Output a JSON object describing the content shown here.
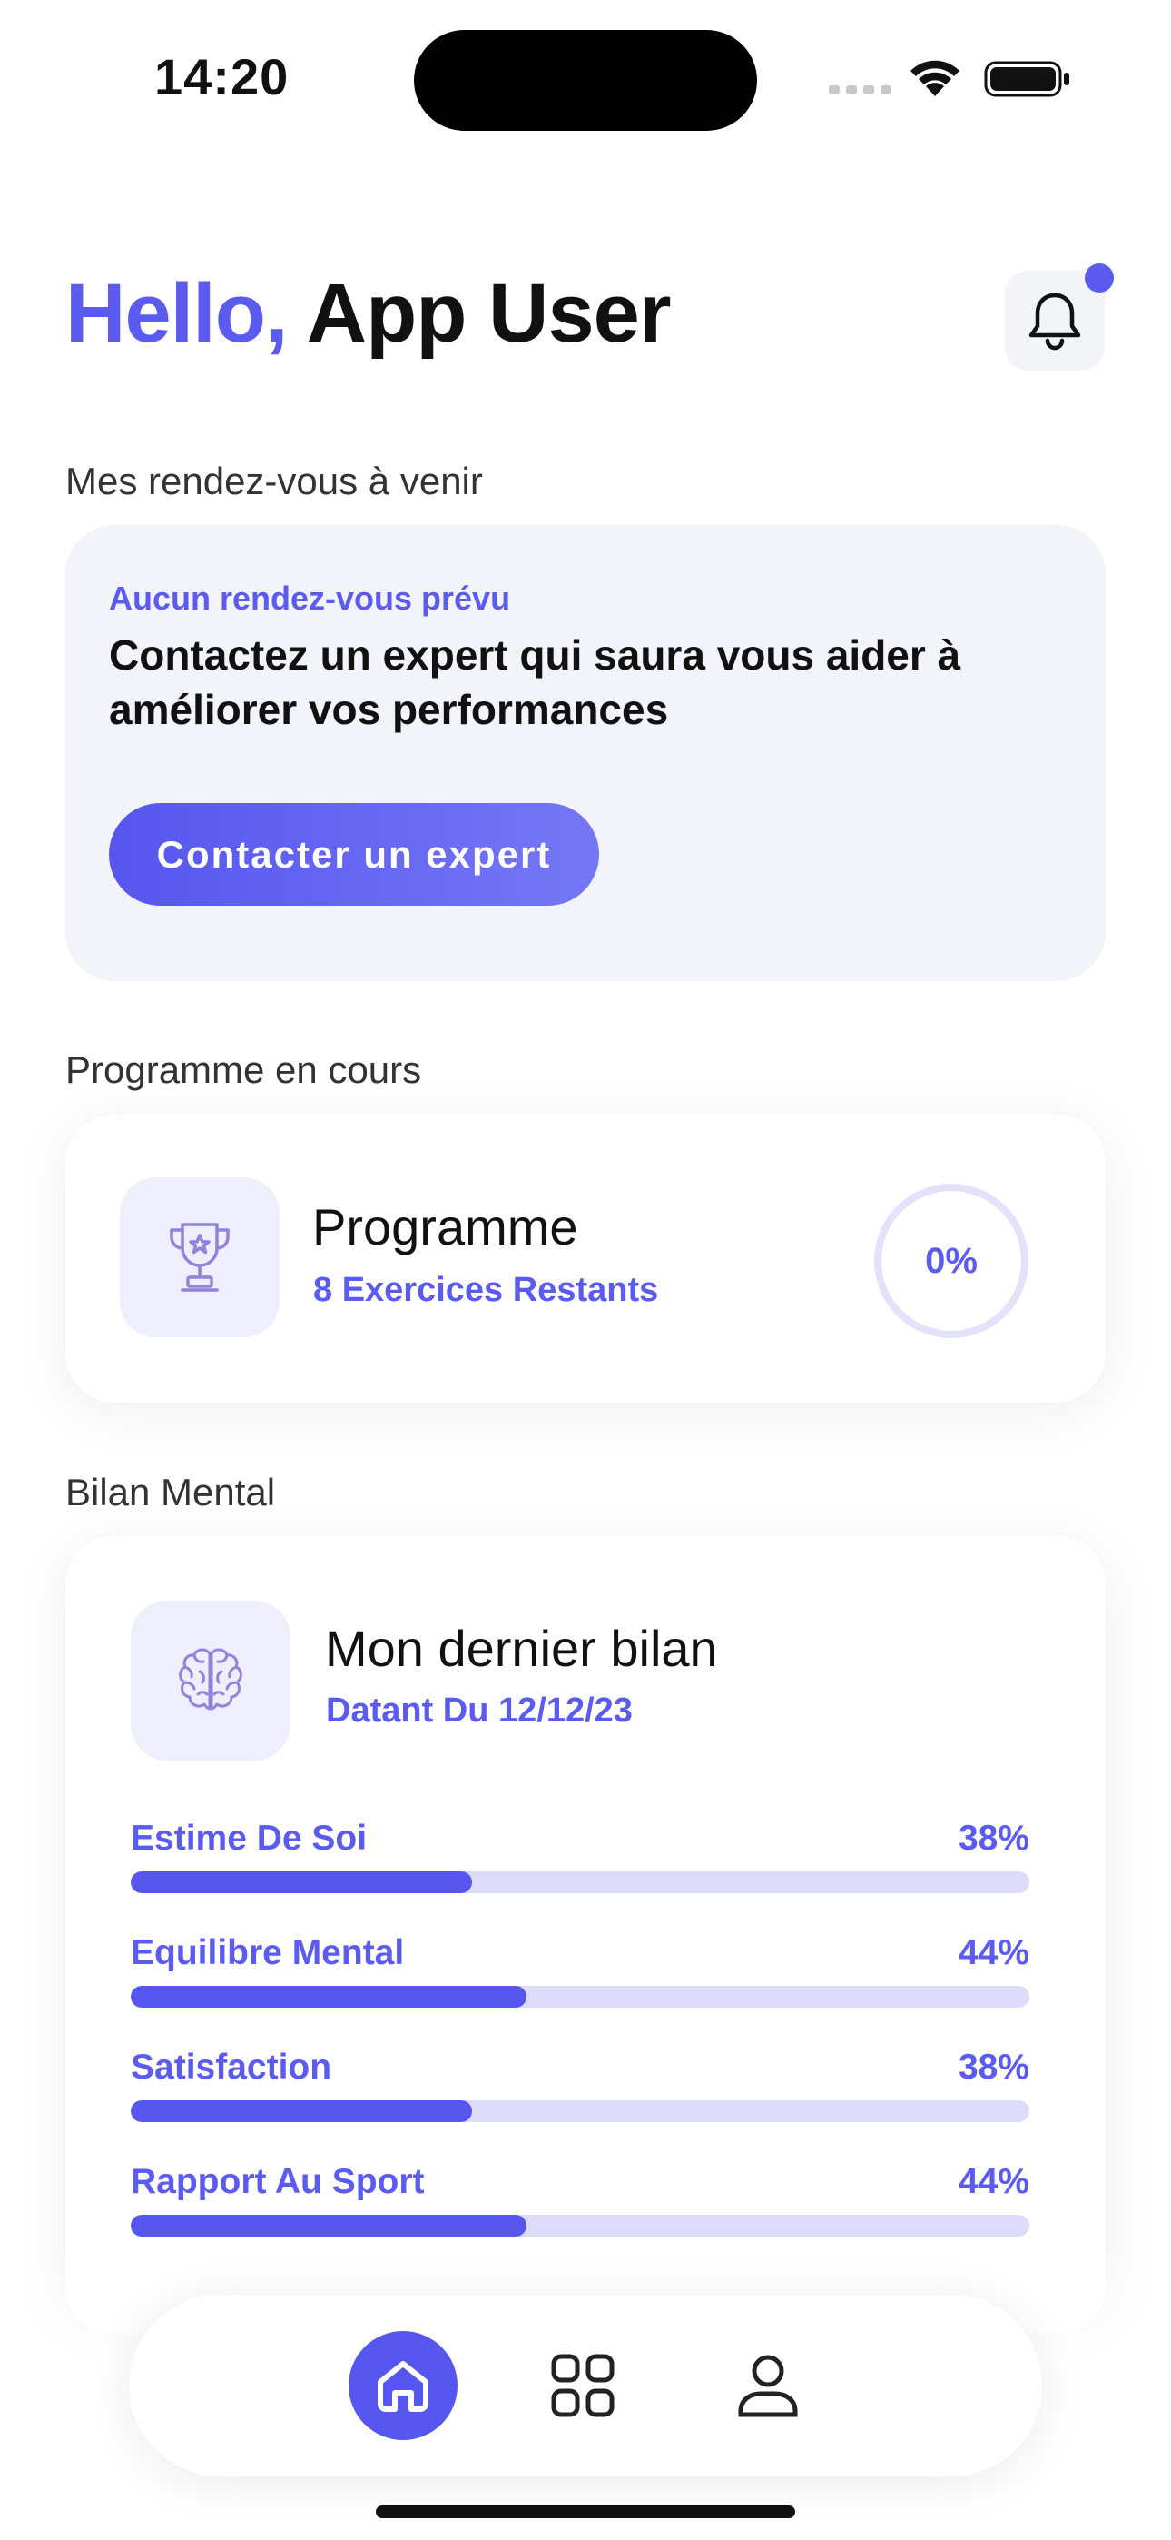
{
  "status_bar": {
    "time": "14:20"
  },
  "header": {
    "hello": "Hello,",
    "user_name": "App User"
  },
  "appointments": {
    "section_title": "Mes rendez-vous à venir",
    "caption": "Aucun rendez-vous prévu",
    "message": "Contactez un expert qui saura vous aider à améliorer vos performances",
    "button_label": "Contacter un expert"
  },
  "program": {
    "section_title": "Programme en cours",
    "title": "Programme",
    "subtitle": "8 Exercices Restants",
    "progress_label": "0%",
    "progress": 0
  },
  "bilan": {
    "section_title": "Bilan Mental",
    "title": "Mon dernier bilan",
    "subtitle": "Datant Du 12/12/23",
    "metrics": [
      {
        "label": "Estime De Soi",
        "value_label": "38%",
        "value": 38
      },
      {
        "label": "Equilibre Mental",
        "value_label": "44%",
        "value": 44
      },
      {
        "label": "Satisfaction",
        "value_label": "38%",
        "value": 38
      },
      {
        "label": "Rapport Au Sport",
        "value_label": "44%",
        "value": 44
      }
    ]
  },
  "navigation": {
    "items": [
      {
        "icon": "home-icon",
        "active": true
      },
      {
        "icon": "grid-icon",
        "active": false
      },
      {
        "icon": "profile-icon",
        "active": false
      }
    ]
  },
  "colors": {
    "accent": "#5b5bf0",
    "accent_light": "#dcdcfa",
    "tile_bg": "#eeeefc",
    "card_bg": "#f3f4f9",
    "text": "#111111"
  }
}
